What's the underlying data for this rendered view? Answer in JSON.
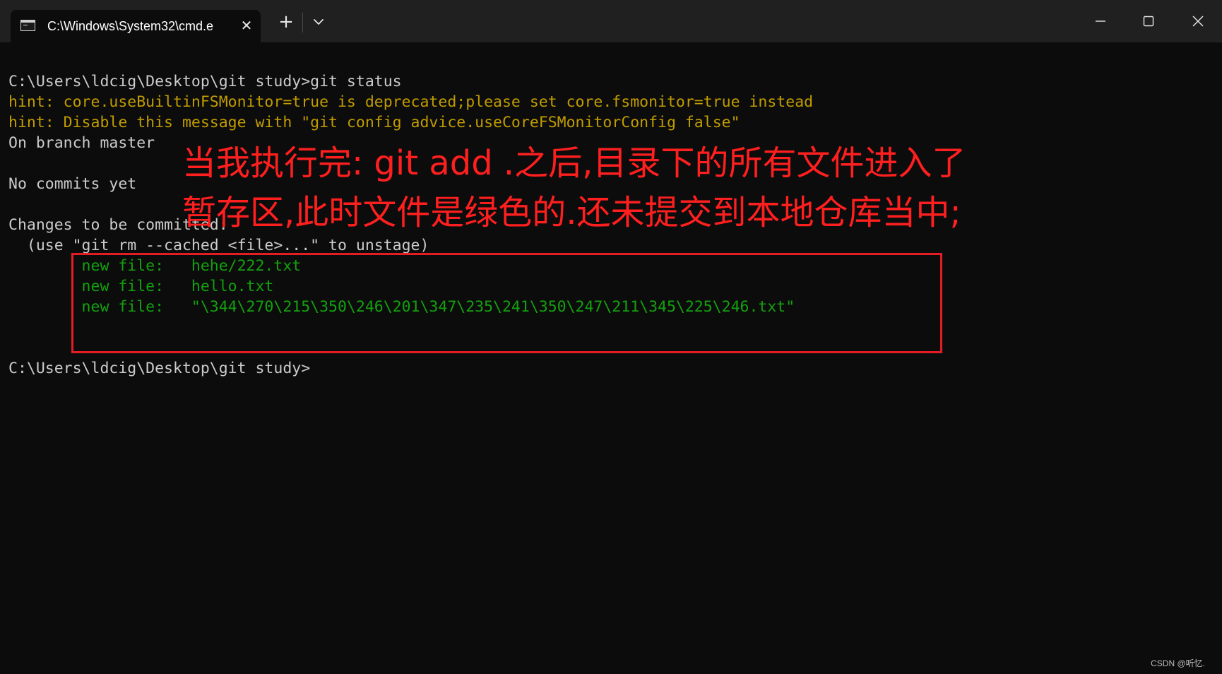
{
  "window": {
    "tab_title": "C:\\Windows\\System32\\cmd.e",
    "new_tab_glyph": "+",
    "tab_close_glyph": "✕",
    "icons": {
      "tab": "terminal-icon",
      "close_tab": "close-icon",
      "new_tab": "plus-icon",
      "dropdown": "chevron-down-icon",
      "minimize": "minimize-icon",
      "maximize": "maximize-icon",
      "close_window": "close-icon"
    }
  },
  "terminal": {
    "lines": [
      {
        "text": "C:\\Users\\ldcig\\Desktop\\git study>git status",
        "color": "#cccccc"
      },
      {
        "text": "hint: core.useBuiltinFSMonitor=true is deprecated;please set core.fsmonitor=true instead",
        "color": "#c19c00"
      },
      {
        "text": "hint: Disable this message with \"git config advice.useCoreFSMonitorConfig false\"",
        "color": "#c19c00"
      },
      {
        "text": "On branch master",
        "color": "#cccccc"
      },
      {
        "text": "",
        "color": "#cccccc"
      },
      {
        "text": "No commits yet",
        "color": "#cccccc"
      },
      {
        "text": "",
        "color": "#cccccc"
      },
      {
        "text": "Changes to be committed:",
        "color": "#cccccc"
      },
      {
        "text": "  (use \"git rm --cached <file>...\" to unstage)",
        "color": "#cccccc"
      },
      {
        "text": "        new file:   hehe/222.txt",
        "color": "#13a10e"
      },
      {
        "text": "        new file:   hello.txt",
        "color": "#13a10e"
      },
      {
        "text": "        new file:   \"\\344\\270\\215\\350\\246\\201\\347\\235\\241\\350\\247\\211\\345\\225\\246.txt\"",
        "color": "#13a10e"
      },
      {
        "text": "",
        "color": "#cccccc"
      },
      {
        "text": "",
        "color": "#cccccc"
      },
      {
        "text": "C:\\Users\\ldcig\\Desktop\\git study>",
        "color": "#cccccc"
      }
    ]
  },
  "annotation": {
    "line1": "当我执行完: git add .之后,目录下的所有文件进入了",
    "line2": "暂存区,此时文件是绿色的.还未提交到本地仓库当中;",
    "color": "#ff1f1f"
  },
  "watermark": "CSDN @听忆."
}
